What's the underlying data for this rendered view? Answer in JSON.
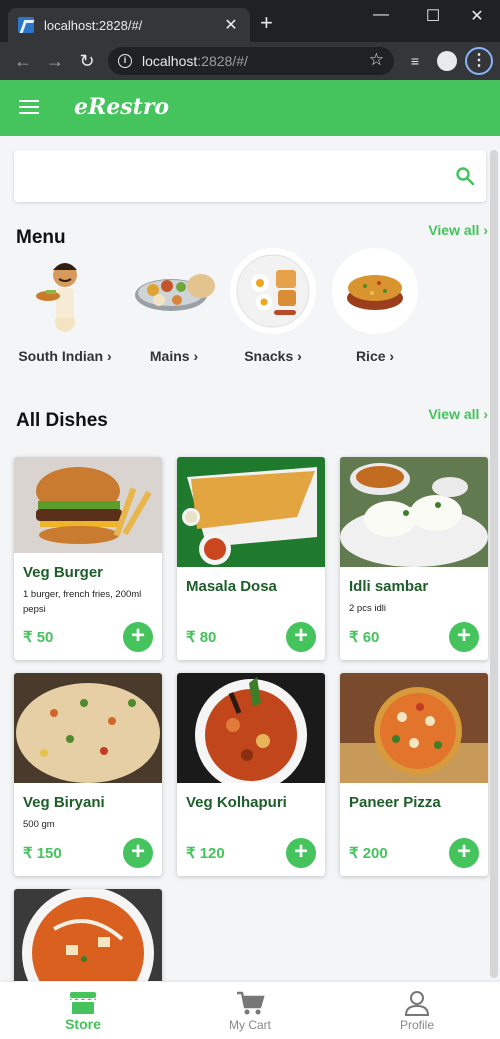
{
  "browser": {
    "tab_title": "localhost:2828/#/",
    "tab_close": "✕",
    "new_tab": "+",
    "url_host": "localhost",
    "url_rest": ":2828/#/"
  },
  "app": {
    "brand": "eRestro"
  },
  "search": {
    "placeholder": ""
  },
  "menu": {
    "title": "Menu",
    "view_all": "View all ›",
    "categories": [
      {
        "label": "South Indian ›"
      },
      {
        "label": "Mains ›"
      },
      {
        "label": "Snacks ›"
      },
      {
        "label": "Rice ›"
      }
    ]
  },
  "dishes": {
    "title": "All Dishes",
    "view_all": "View all ›",
    "items": [
      {
        "name": "Veg Burger",
        "desc": "1 burger, french fries, 200ml pepsi",
        "price": "₹ 50"
      },
      {
        "name": "Masala Dosa",
        "desc": "",
        "price": "₹ 80"
      },
      {
        "name": "Idli sambar",
        "desc": "2 pcs idli",
        "price": "₹ 60"
      },
      {
        "name": "Veg Biryani",
        "desc": "500 gm",
        "price": "₹ 150"
      },
      {
        "name": "Veg Kolhapuri",
        "desc": "",
        "price": "₹ 120"
      },
      {
        "name": "Paneer Pizza",
        "desc": "",
        "price": "₹ 200"
      }
    ],
    "add_label": "+"
  },
  "bottom_nav": {
    "items": [
      {
        "label": "Store",
        "icon": "store-icon",
        "active": true
      },
      {
        "label": "My Cart",
        "icon": "cart-icon",
        "active": false
      },
      {
        "label": "Profile",
        "icon": "profile-icon",
        "active": false
      }
    ]
  },
  "colors": {
    "accent": "#45c35c",
    "dish_name": "#1e5e2a",
    "browser_dark": "#202124"
  }
}
